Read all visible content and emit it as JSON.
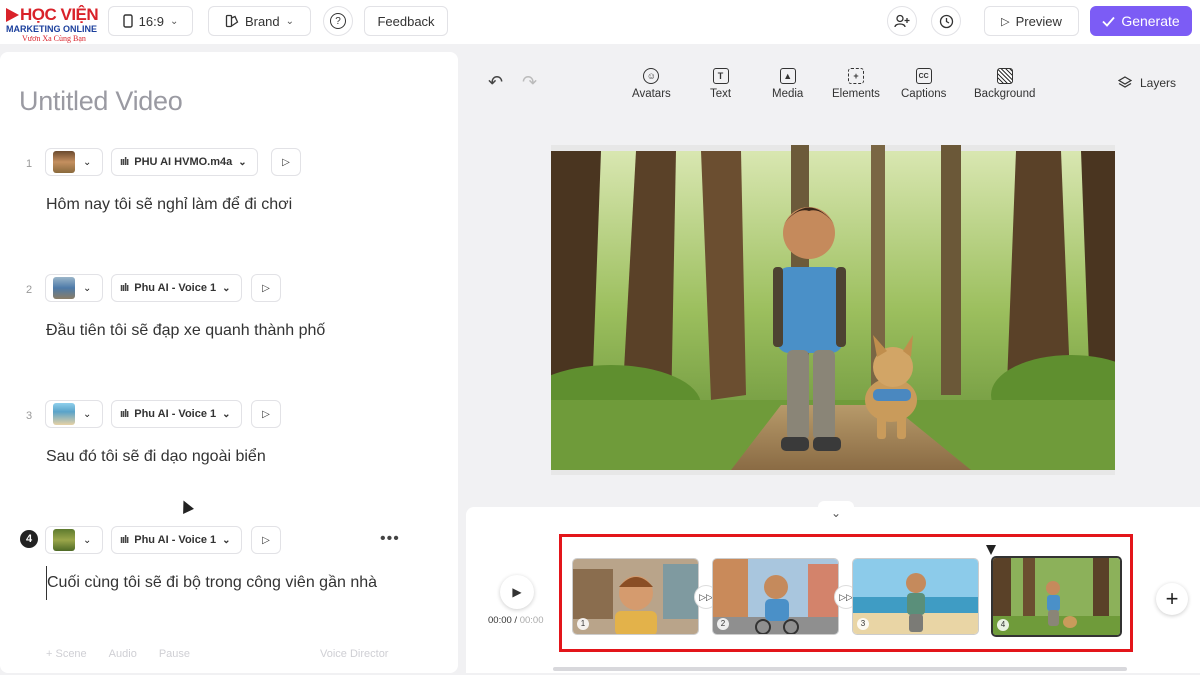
{
  "logo": {
    "main": "HỌC VIỆN",
    "sub": "MARKETING ONLINE",
    "tagline": "Vươn Xa Cùng Bạn"
  },
  "topbar": {
    "aspect_ratio": "16:9",
    "brand_label": "Brand",
    "help_icon": "?",
    "feedback_label": "Feedback",
    "preview_label": "Preview",
    "generate_label": "Generate"
  },
  "video": {
    "title": "Untitled Video"
  },
  "scenes": [
    {
      "num": "1",
      "voice": "PHU AI HVMO.m4a",
      "text": "Hôm nay tôi sẽ nghỉ làm để đi chơi"
    },
    {
      "num": "2",
      "voice": "Phu AI - Voice 1",
      "text": "Đầu tiên tôi sẽ đạp xe quanh thành phố"
    },
    {
      "num": "3",
      "voice": "Phu AI - Voice 1",
      "text": "Sau đó tôi sẽ đi dạo ngoài biển"
    },
    {
      "num": "4",
      "voice": "Phu AI - Voice 1",
      "text": "Cuối cùng tôi sẽ đi bộ trong công viên gần nhà"
    }
  ],
  "scene_footer": {
    "scene": "+ Scene",
    "audio": "Audio",
    "pause": "Pause",
    "voice_director": "Voice Director"
  },
  "tools": [
    {
      "label": "Avatars",
      "icon": "avatar-icon"
    },
    {
      "label": "Text",
      "icon": "text-icon"
    },
    {
      "label": "Media",
      "icon": "media-icon"
    },
    {
      "label": "Elements",
      "icon": "elements-icon"
    },
    {
      "label": "Captions",
      "icon": "captions-icon"
    },
    {
      "label": "Background",
      "icon": "background-icon"
    }
  ],
  "layers_label": "Layers",
  "timeline": {
    "current_time": "00:00",
    "separator": " / ",
    "duration": "00:00",
    "clips": [
      "1",
      "2",
      "3",
      "4"
    ]
  },
  "colors": {
    "accent": "#7c5cf5",
    "highlight": "#e3151a"
  }
}
